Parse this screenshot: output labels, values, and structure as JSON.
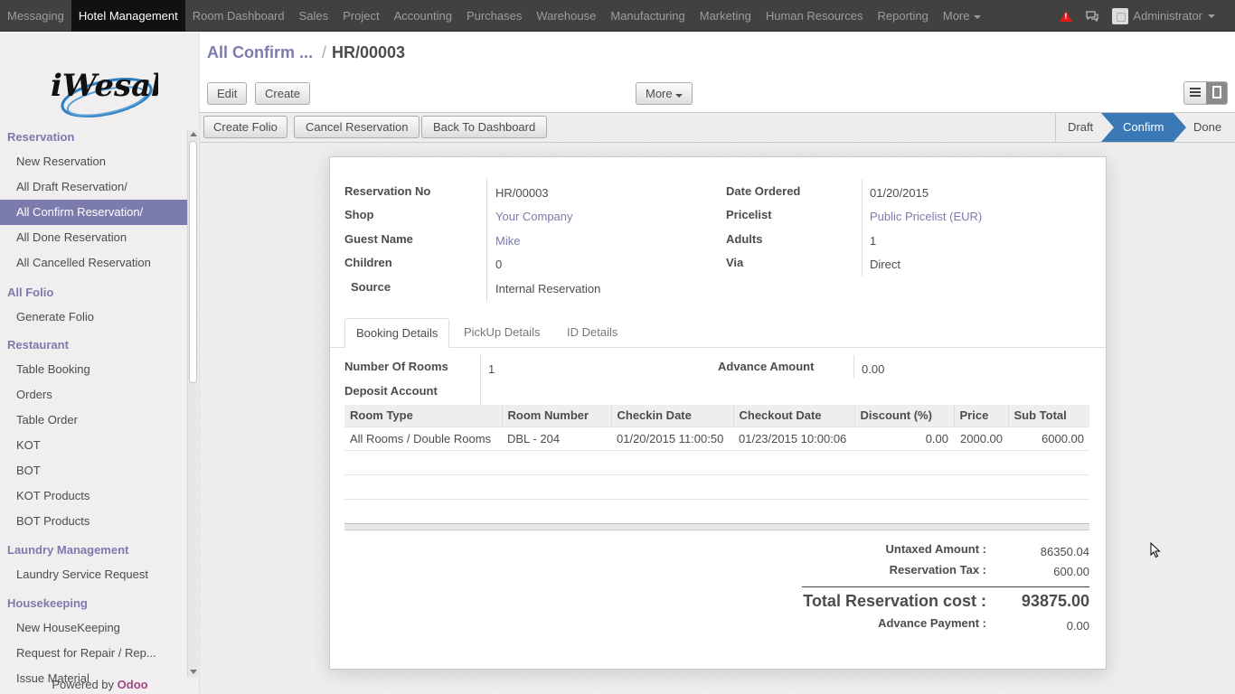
{
  "topbar": {
    "menu": [
      "Messaging",
      "Hotel Management",
      "Room Dashboard",
      "Sales",
      "Project",
      "Accounting",
      "Purchases",
      "Warehouse",
      "Manufacturing",
      "Marketing",
      "Human Resources",
      "Reporting",
      "More"
    ],
    "active_menu": "Hotel Management",
    "user": "Administrator"
  },
  "sidebar": {
    "logo_text": "iWesabe",
    "sections": [
      {
        "title": "Reservation",
        "items": [
          "New Reservation",
          "All Draft Reservation/",
          "All Confirm Reservation/",
          "All Done Reservation",
          "All Cancelled Reservation"
        ]
      },
      {
        "title": "All Folio",
        "items": [
          "Generate Folio"
        ]
      },
      {
        "title": "Restaurant",
        "items": [
          "Table Booking",
          "Orders",
          "Table Order",
          "KOT",
          "BOT",
          "KOT Products",
          "BOT Products"
        ]
      },
      {
        "title": "Laundry Management",
        "items": [
          "Laundry Service Request"
        ]
      },
      {
        "title": "Housekeeping",
        "items": [
          "New HouseKeeping",
          "Request for Repair / Rep...",
          "Issue Material"
        ]
      }
    ],
    "active_item": "All Confirm Reservation/",
    "powered_by": "Powered by",
    "powered_brand": "Odoo"
  },
  "breadcrumb": {
    "parent": "All Confirm ...",
    "separator": "/",
    "current": "HR/00003"
  },
  "toolbar": {
    "edit": "Edit",
    "create": "Create",
    "more": "More"
  },
  "header_buttons": {
    "create_folio": "Create Folio",
    "cancel_reservation": "Cancel Reservation",
    "back_to_dashboard": "Back To Dashboard"
  },
  "stages": {
    "draft": "Draft",
    "confirm": "Confirm",
    "done": "Done",
    "current": "Confirm"
  },
  "form": {
    "labels": {
      "reservation_no": "Reservation No",
      "shop": "Shop",
      "guest_name": "Guest Name",
      "children": "Children",
      "source": "Source",
      "date_ordered": "Date Ordered",
      "pricelist": "Pricelist",
      "adults": "Adults",
      "via": "Via"
    },
    "values": {
      "reservation_no": "HR/00003",
      "shop": "Your Company",
      "guest_name": "Mike",
      "children": "0",
      "source": "Internal Reservation",
      "date_ordered": "01/20/2015",
      "pricelist": "Public Pricelist (EUR)",
      "adults": "1",
      "via": "Direct"
    }
  },
  "tabs": [
    "Booking Details",
    "PickUp Details",
    "ID Details"
  ],
  "booking": {
    "labels": {
      "number_of_rooms": "Number Of Rooms",
      "deposit_account": "Deposit Account",
      "advance_amount": "Advance Amount"
    },
    "values": {
      "number_of_rooms": "1",
      "deposit_account": "",
      "advance_amount": "0.00"
    }
  },
  "lines": {
    "columns": [
      "Room Type",
      "Room Number",
      "Checkin Date",
      "Checkout Date",
      "Discount (%)",
      "Price",
      "Sub Total"
    ],
    "rows": [
      [
        "All Rooms / Double Rooms",
        "DBL - 204",
        "01/20/2015 11:00:50",
        "01/23/2015 10:00:06",
        "0.00",
        "2000.00",
        "6000.00"
      ]
    ]
  },
  "totals": {
    "untaxed_label": "Untaxed Amount :",
    "untaxed": "86350.04",
    "tax_label": "Reservation Tax :",
    "tax": "600.00",
    "total_label": "Total Reservation cost :",
    "total": "93875.00",
    "advance_label": "Advance Payment :",
    "advance": "0.00"
  }
}
